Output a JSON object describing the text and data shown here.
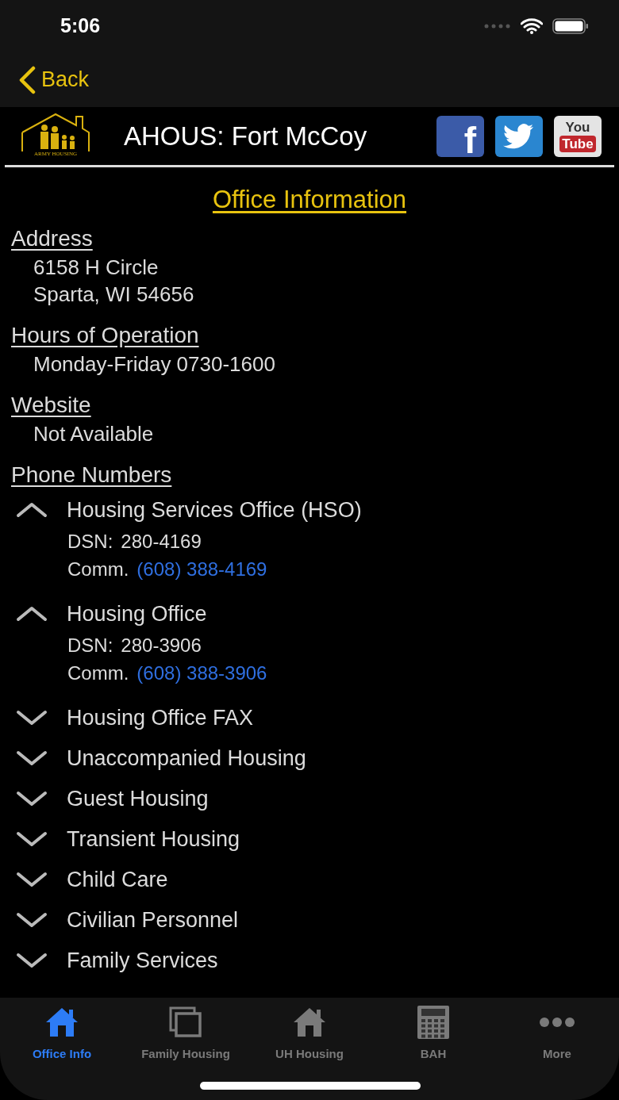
{
  "status_bar": {
    "time": "5:06"
  },
  "nav": {
    "back_label": "Back"
  },
  "header": {
    "logo_text": "ARMY HOUSING",
    "title": "AHOUS: Fort McCoy",
    "social": [
      {
        "kind": "facebook",
        "lines": [
          "f"
        ]
      },
      {
        "kind": "twitter"
      },
      {
        "kind": "youtube",
        "lines": [
          "You",
          "Tube"
        ]
      }
    ]
  },
  "page_title": "Office Information",
  "sections": [
    {
      "heading": "Address",
      "lines": [
        "6158 H Circle",
        "Sparta, WI 54656"
      ]
    },
    {
      "heading": "Hours of Operation",
      "lines": [
        "Monday-Friday 0730-1600"
      ]
    },
    {
      "heading": "Website",
      "lines": [
        "Not Available"
      ]
    }
  ],
  "phone_numbers": {
    "heading": "Phone Numbers",
    "items": [
      {
        "label": "Housing Services Office (HSO)",
        "expanded": true,
        "details": [
          {
            "kind": "plain",
            "label": "DSN:",
            "value": "280-4169"
          },
          {
            "kind": "link",
            "label": "Comm.",
            "value": "(608) 388-4169"
          }
        ]
      },
      {
        "label": "Housing Office",
        "expanded": true,
        "details": [
          {
            "kind": "plain",
            "label": "DSN:",
            "value": "280-3906"
          },
          {
            "kind": "link",
            "label": "Comm.",
            "value": "(608) 388-3906"
          }
        ]
      },
      {
        "label": "Housing Office FAX",
        "expanded": false
      },
      {
        "label": "Unaccompanied Housing",
        "expanded": false
      },
      {
        "label": "Guest Housing",
        "expanded": false
      },
      {
        "label": "Transient Housing",
        "expanded": false
      },
      {
        "label": "Child Care",
        "expanded": false
      },
      {
        "label": "Civilian Personnel",
        "expanded": false
      },
      {
        "label": "Family Services",
        "expanded": false
      }
    ]
  },
  "tabs": [
    {
      "label": "Office Info",
      "kind": "house",
      "selected": true
    },
    {
      "label": "Family Housing",
      "kind": "windows",
      "selected": false
    },
    {
      "label": "UH Housing",
      "kind": "house",
      "selected": false
    },
    {
      "label": "BAH",
      "kind": "calculator",
      "selected": false
    },
    {
      "label": "More",
      "kind": "dots",
      "selected": false
    }
  ]
}
